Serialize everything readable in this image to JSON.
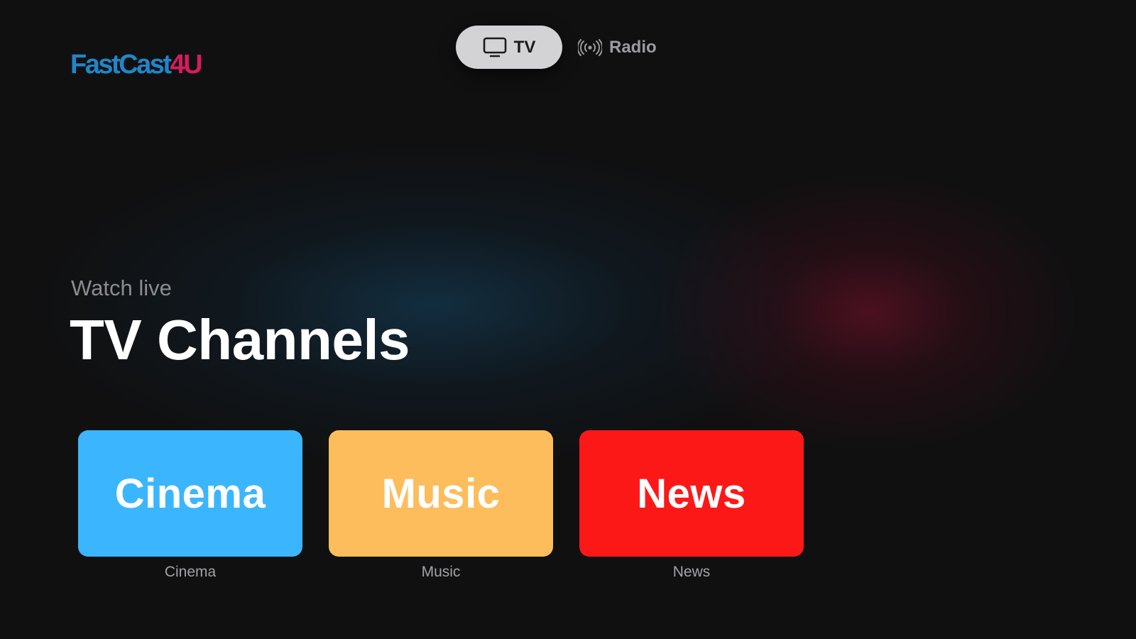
{
  "brand": {
    "logo_part_a": "FastCast",
    "logo_part_b": "4U",
    "color_a": "#1e87c9",
    "color_b": "#d61c5c"
  },
  "nav": {
    "tabs": [
      {
        "label": "TV",
        "icon": "tv-icon",
        "active": true
      },
      {
        "label": "Radio",
        "icon": "radio-broadcast-icon",
        "active": false
      }
    ]
  },
  "hero": {
    "subtitle": "Watch live",
    "title": "TV Channels"
  },
  "categories": [
    {
      "tile_text": "Cinema",
      "caption": "Cinema",
      "color": "#3bb6fe"
    },
    {
      "tile_text": "Music",
      "caption": "Music",
      "color": "#fdbd5c"
    },
    {
      "tile_text": "News",
      "caption": "News",
      "color": "#fd1818"
    }
  ]
}
